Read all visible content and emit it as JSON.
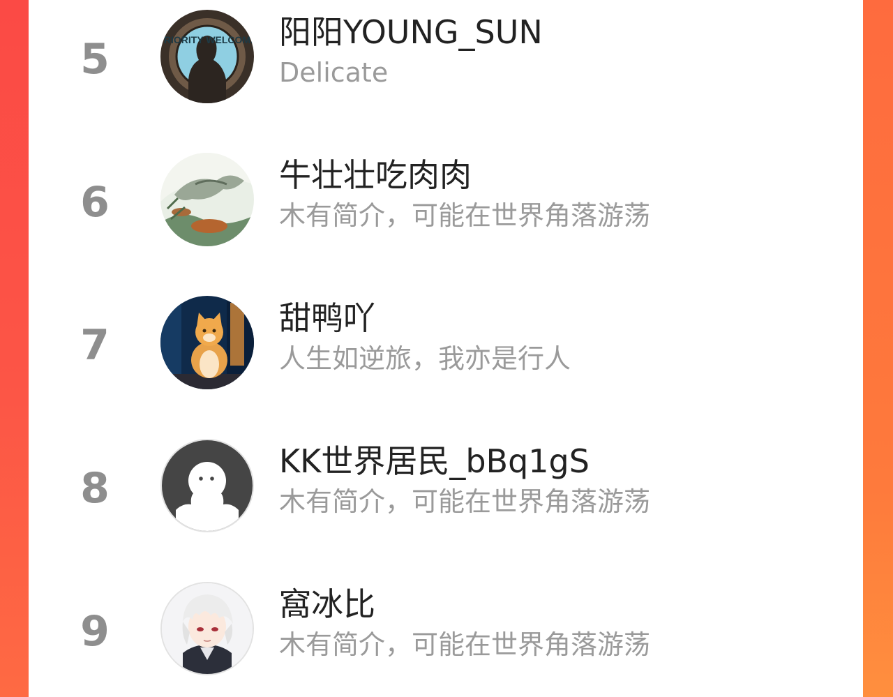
{
  "theme": {
    "accent_left": "#fb4a45",
    "accent_right": "#fe7a3c",
    "rank_color": "#8e8e8e",
    "name_color": "#222222",
    "bio_color": "#9a9a9a"
  },
  "ranking": {
    "items": [
      {
        "rank": "5",
        "name": "阳阳YOUNG_SUN",
        "bio": "Delicate",
        "avatar_icon": "silhouette-photo-avatar",
        "avatar_text": "PRIORITY WELCOME"
      },
      {
        "rank": "6",
        "name": "牛壮壮吃肉肉",
        "bio": "木有简介，可能在世界角落游荡",
        "avatar_icon": "ink-painting-avatar"
      },
      {
        "rank": "7",
        "name": "甜鸭吖",
        "bio": "人生如逆旅，我亦是行人",
        "avatar_icon": "orange-cat-avatar"
      },
      {
        "rank": "8",
        "name": "KK世界居民_bBq1gS",
        "bio": "木有简介，可能在世界角落游荡",
        "avatar_icon": "default-user-avatar"
      },
      {
        "rank": "9",
        "name": "窩冰比",
        "bio": "木有简介，可能在世界角落游荡",
        "avatar_icon": "anime-character-avatar"
      }
    ]
  }
}
